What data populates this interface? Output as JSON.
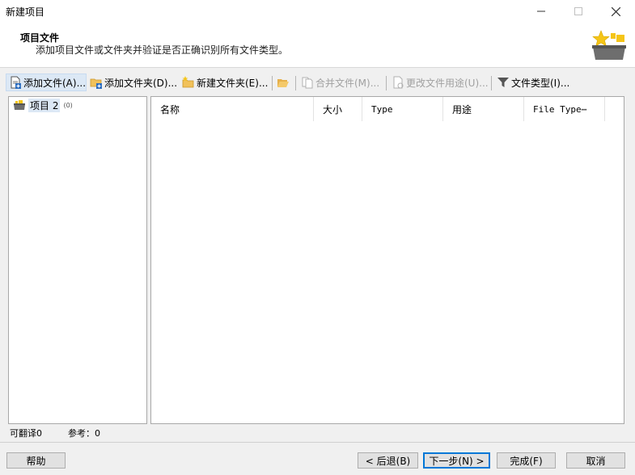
{
  "window": {
    "title": "新建项目",
    "minimize_icon": "minimize-icon",
    "maximize_icon": "maximize-icon",
    "close_icon": "close-icon"
  },
  "header": {
    "title": "项目文件",
    "description": "添加项目文件或文件夹并验证是否正确识别所有文件类型。",
    "icon": "star-box-icon"
  },
  "toolbar": {
    "add_file": "添加文件(A)...",
    "add_folder": "添加文件夹(D)...",
    "new_folder": "新建文件夹(E)...",
    "merge_files": "合并文件(M)...",
    "change_usage": "更改文件用途(U)...",
    "file_types": "文件类型(I)..."
  },
  "tree": {
    "project_name": "项目 2",
    "project_count": "(0)"
  },
  "filelist": {
    "columns": [
      "名称",
      "大小",
      "Type",
      "用途",
      "File Type⋯"
    ]
  },
  "status": {
    "translatable": "可翻译0",
    "reference": "参考：0"
  },
  "buttons": {
    "help": "帮助",
    "back": "< 后退(B)",
    "next": "下一步(N) >",
    "finish": "完成(F)",
    "cancel": "取消"
  },
  "colors": {
    "selection": "#dce8f5",
    "accent": "#0078d7",
    "star": "#f5c518"
  }
}
